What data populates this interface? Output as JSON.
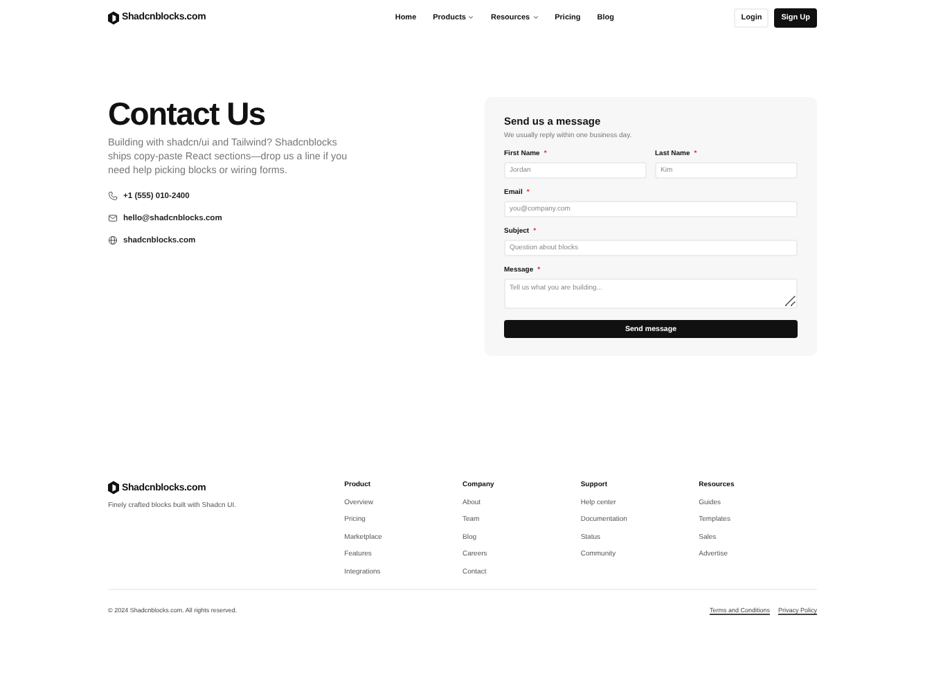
{
  "header": {
    "brand": "Shadcnblocks.com",
    "nav": [
      {
        "label": "Home",
        "has_menu": false
      },
      {
        "label": "Products",
        "has_menu": true
      },
      {
        "label": "Resources",
        "has_menu": true
      },
      {
        "label": "Pricing",
        "has_menu": false
      },
      {
        "label": "Blog",
        "has_menu": false
      }
    ],
    "login": "Login",
    "signup": "Sign Up"
  },
  "hero": {
    "title": "Contact Us",
    "intro": "Building with shadcn/ui and Tailwind? Shadcnblocks ships copy-paste React sections—drop us a line if you need help picking blocks or wiring forms.",
    "contacts": [
      {
        "kind": "phone",
        "text": "+1 (555) 010-2400"
      },
      {
        "kind": "email",
        "text": "hello@shadcnblocks.com"
      },
      {
        "kind": "web",
        "text": "shadcnblocks.com"
      }
    ]
  },
  "form": {
    "title": "Send us a message",
    "subtitle": "We usually reply within one business day.",
    "fields": [
      {
        "label": "First Name",
        "required_mark": "*",
        "placeholder": "Jordan",
        "kind": "input"
      },
      {
        "label": "Last Name",
        "required_mark": "*",
        "placeholder": "Kim",
        "kind": "input"
      },
      {
        "label": "Email",
        "required_mark": "*",
        "placeholder": "you@company.com",
        "kind": "input"
      },
      {
        "label": "Subject",
        "required_mark": "*",
        "placeholder": "Question about blocks",
        "kind": "input"
      },
      {
        "label": "Message",
        "required_mark": "*",
        "placeholder": "Tell us what you are building...",
        "kind": "textarea"
      }
    ],
    "submit": "Send message"
  },
  "footer": {
    "brand": "Shadcnblocks.com",
    "tagline": "Finely crafted blocks built with Shadcn UI.",
    "columns": [
      {
        "title": "Product",
        "links": [
          "Overview",
          "Pricing",
          "Marketplace",
          "Features",
          "Integrations"
        ]
      },
      {
        "title": "Company",
        "links": [
          "About",
          "Team",
          "Blog",
          "Careers",
          "Contact"
        ]
      },
      {
        "title": "Support",
        "links": [
          "Help center",
          "Documentation",
          "Status",
          "Community"
        ]
      },
      {
        "title": "Resources",
        "links": [
          "Guides",
          "Templates",
          "Sales",
          "Advertise"
        ]
      }
    ],
    "copyright": "© 2024 Shadcnblocks.com. All rights reserved.",
    "legal": [
      "Terms and Conditions",
      "Privacy Policy"
    ]
  }
}
